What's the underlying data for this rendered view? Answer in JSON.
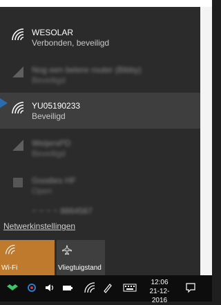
{
  "networks": [
    {
      "name": "WESOLAR",
      "status": "Verbonden, beveiligd"
    },
    {
      "name": "Nog een betere router (Bibby)",
      "status": "Beveiligd"
    },
    {
      "name": "YU05190233",
      "status": "Beveiligd"
    },
    {
      "name": "WeijersPD",
      "status": "Beveiligd"
    },
    {
      "name": "Goodies HF",
      "status": "Open"
    },
    {
      "name": "~ ~ ~ ~ 8864567",
      "status": ""
    }
  ],
  "settings_link": "Netwerkinstellingen",
  "quick_actions": {
    "wifi_label": "Wi-Fi",
    "airplane_label": "Vliegtuigstand"
  },
  "taskbar": {
    "time": "12:06",
    "date": "21-12-2016"
  },
  "colors": {
    "panel": "#2b2b2b",
    "accent": "#c07a2e",
    "selected_row": "#3e3e3e",
    "taskbar": "#0d0d0d"
  }
}
